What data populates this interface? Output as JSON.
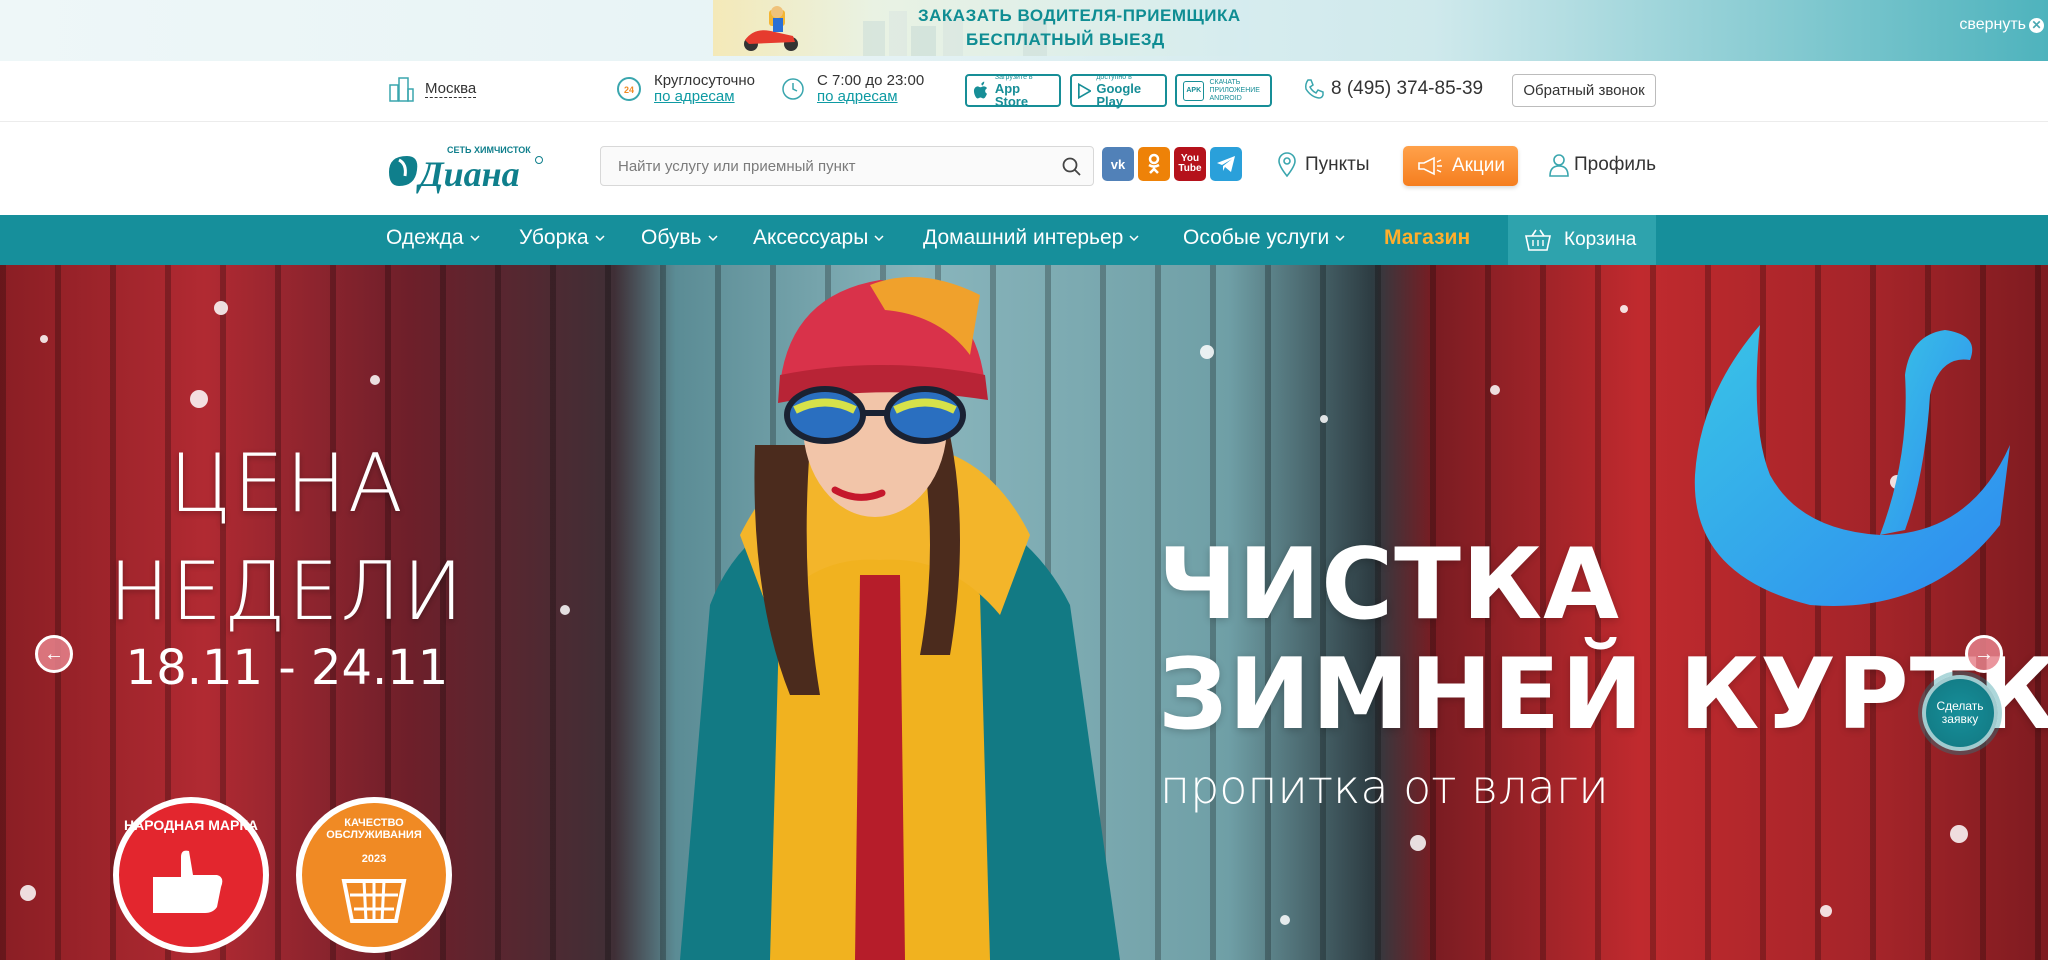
{
  "promo": {
    "line1": "ЗАКАЗАТЬ ВОДИТЕЛЯ-ПРИЕМЩИКА",
    "line2": "БЕСПЛАТНЫЙ ВЫЕЗД",
    "collapse_label": "свернуть"
  },
  "info": {
    "city": "Москва",
    "hours1": {
      "title": "Круглосуточно",
      "link": "по адресам"
    },
    "hours2": {
      "title": "С 7:00 до 23:00",
      "link": "по адресам"
    },
    "appstore": {
      "small": "Загрузите в",
      "big": "App Store"
    },
    "googleplay": {
      "small": "доступно в",
      "big": "Google Play"
    },
    "apk": {
      "small": "СКАЧАТЬ ПРИЛОЖЕНИЕ ANDROID",
      "badge": "APK"
    },
    "phone": "8 (495) 374-85-39",
    "callback": "Обратный звонок"
  },
  "header": {
    "logo_small": "СЕТЬ ХИМЧИСТОК",
    "logo_big": "Диана",
    "search_placeholder": "Найти услугу или приемный пункт",
    "social": {
      "vk": "vk",
      "youtube": "You Tube"
    },
    "points": "Пункты",
    "promotions": "Акции",
    "profile": "Профиль"
  },
  "nav": {
    "items": [
      {
        "label": "Одежда"
      },
      {
        "label": "Уборка"
      },
      {
        "label": "Обувь"
      },
      {
        "label": "Аксессуары"
      },
      {
        "label": "Домашний интерьер"
      },
      {
        "label": "Особые услуги"
      }
    ],
    "shop": "Магазин",
    "cart": "Корзина"
  },
  "hero": {
    "left_title_1": "ЦЕНА",
    "left_title_2": "НЕДЕЛИ",
    "dates": "18.11 - 24.11",
    "badge1": "НАРОДНАЯ МАРКА",
    "badge2": "КАЧЕСТВО ОБСЛУЖИВАНИЯ",
    "badge2_year": "2023",
    "title_1": "ЧИСТКА",
    "title_2": "ЗИМНЕЙ КУРТКИ",
    "subtitle": "пропитка от влаги",
    "order_button": "Сделать заявку"
  },
  "colors": {
    "brand_teal": "#168f9b",
    "accent_orange": "#f57e1f",
    "shop_yellow": "#ffae2c"
  }
}
